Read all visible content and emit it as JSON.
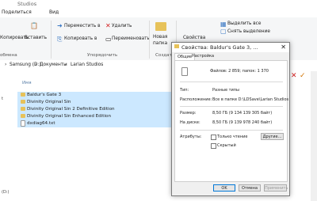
{
  "window": {
    "title": "Studios"
  },
  "ribbon_tabs": [
    "Поделиться",
    "Вид"
  ],
  "ribbon": {
    "copy": "Копировать",
    "paste": "Вставить",
    "clipboard_group": "обмена",
    "move_to": "Переместить в",
    "copy_to": "Копировать в",
    "delete": "Удалить",
    "rename": "Переименовать",
    "organize_group": "Упорядочить",
    "new_folder_1": "Новая",
    "new_folder_2": "папка",
    "create_group": "Создат",
    "properties": "Свойства",
    "select_all": "Выделить все",
    "select_none": "Снять выделение"
  },
  "address": {
    "parts": [
      "Samsung (D:)",
      "Документы",
      "Larian Studios"
    ]
  },
  "nav_items": [
    "t",
    "",
    "",
    "",
    "",
    "",
    "",
    "(D:)"
  ],
  "files": {
    "column_name": "Имя",
    "rows": [
      "Baldur's Gate 3",
      "Divinity Original Sin",
      "Divinity Original Sin 2 Definitive Edition",
      "Divinity Original Sin Enhanced Edition",
      "dxdiag64.txt"
    ]
  },
  "dialog": {
    "title": "Свойства: Baldur's Gate 3, ...",
    "tab_general": "Общие",
    "tab_settings": "Настройка",
    "summary": "Файлов: 2 859; папок: 1 370",
    "type_label": "Тип:",
    "type_value": "Разные типы",
    "location_label": "Расположение:",
    "location_value": "Все в папке D:\\LDSave\\Larian Studios",
    "size_label": "Размер:",
    "size_value": "8,50 ГБ (9 134 139 305 байт)",
    "disk_label": "На диске:",
    "disk_value": "8,50 ГБ (9 139 978 240 байт)",
    "attr_label": "Атрибуты:",
    "readonly": "Только чтение",
    "hidden": "Скрытый",
    "other_btn": "Другие...",
    "ok": "OK",
    "cancel": "Отмена",
    "apply": "Применить"
  }
}
